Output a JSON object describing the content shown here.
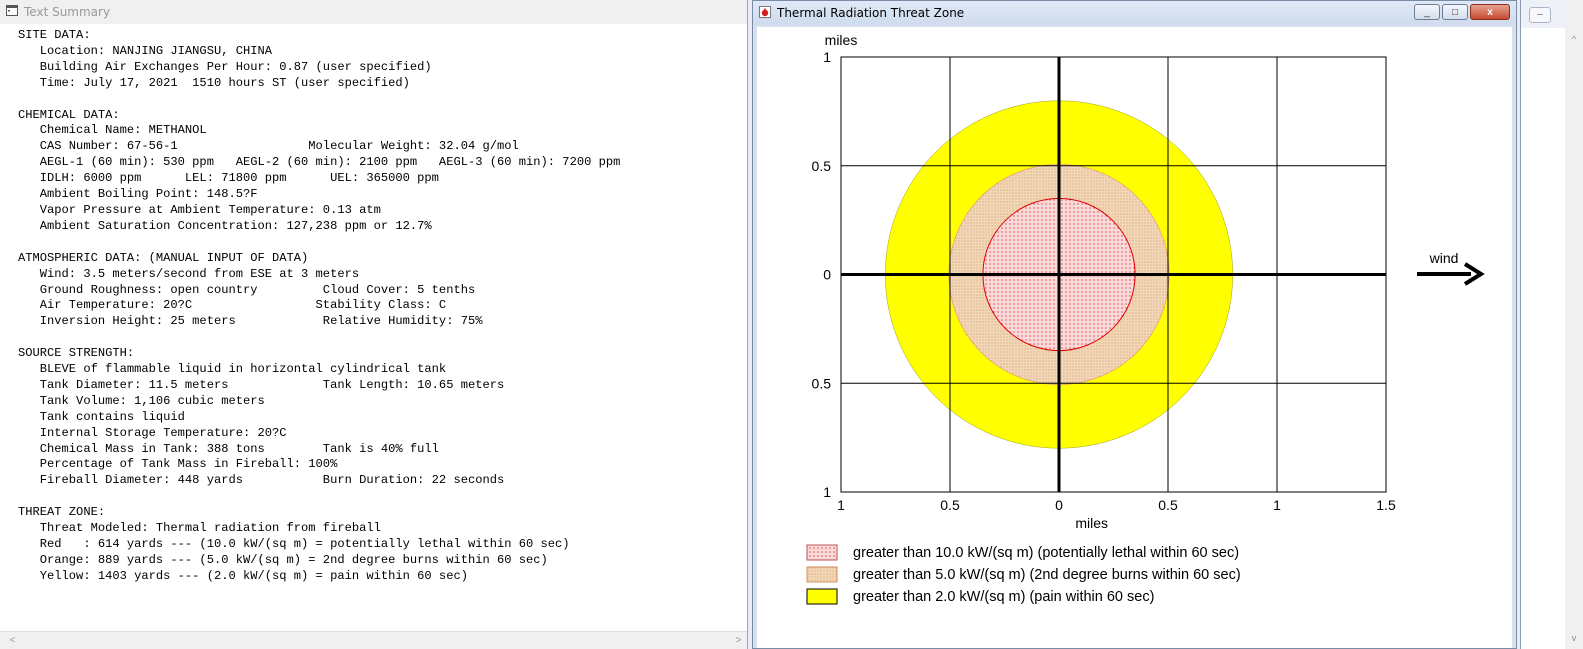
{
  "summary_window": {
    "title": "Text Summary",
    "lines": [
      "SITE DATA:",
      "   Location: NANJING JIANGSU, CHINA",
      "   Building Air Exchanges Per Hour: 0.87 (user specified)",
      "   Time: July 17, 2021  1510 hours ST (user specified)",
      "",
      "CHEMICAL DATA:",
      "   Chemical Name: METHANOL",
      "   CAS Number: 67-56-1                  Molecular Weight: 32.04 g/mol",
      "   AEGL-1 (60 min): 530 ppm   AEGL-2 (60 min): 2100 ppm   AEGL-3 (60 min): 7200 ppm",
      "   IDLH: 6000 ppm      LEL: 71800 ppm      UEL: 365000 ppm",
      "   Ambient Boiling Point: 148.5?F",
      "   Vapor Pressure at Ambient Temperature: 0.13 atm",
      "   Ambient Saturation Concentration: 127,238 ppm or 12.7%",
      "",
      "ATMOSPHERIC DATA: (MANUAL INPUT OF DATA)",
      "   Wind: 3.5 meters/second from ESE at 3 meters",
      "   Ground Roughness: open country         Cloud Cover: 5 tenths",
      "   Air Temperature: 20?C                 Stability Class: C",
      "   Inversion Height: 25 meters            Relative Humidity: 75%",
      "",
      "SOURCE STRENGTH:",
      "   BLEVE of flammable liquid in horizontal cylindrical tank",
      "   Tank Diameter: 11.5 meters             Tank Length: 10.65 meters",
      "   Tank Volume: 1,106 cubic meters",
      "   Tank contains liquid",
      "   Internal Storage Temperature: 20?C",
      "   Chemical Mass in Tank: 388 tons        Tank is 40% full",
      "   Percentage of Tank Mass in Fireball: 100%",
      "   Fireball Diameter: 448 yards           Burn Duration: 22 seconds",
      "",
      "THREAT ZONE:",
      "   Threat Modeled: Thermal radiation from fireball",
      "   Red   : 614 yards --- (10.0 kW/(sq m) = potentially lethal within 60 sec)",
      "   Orange: 889 yards --- (5.0 kW/(sq m) = 2nd degree burns within 60 sec)",
      "   Yellow: 1403 yards --- (2.0 kW/(sq m) = pain within 60 sec)"
    ]
  },
  "threat_window": {
    "title": "Thermal Radiation Threat Zone",
    "buttons": {
      "minimize": "_",
      "maximize": "□",
      "close": "x"
    }
  },
  "colors": {
    "red": "#e00000",
    "red_fill": "#f8dada",
    "orange_fill": "#f2d8b8",
    "orange_stroke": "#e8a070",
    "yellow": "#ffff00"
  },
  "chart_data": {
    "type": "area",
    "y_axis_label": "miles",
    "x_axis_label": "miles",
    "x_ticks": [
      "1",
      "0.5",
      "0",
      "0.5",
      "1",
      "1.5"
    ],
    "x_tick_values": [
      -1,
      -0.5,
      0,
      0.5,
      1,
      1.5
    ],
    "y_ticks": [
      "1",
      "0.5",
      "0",
      "0.5",
      "1"
    ],
    "y_tick_values": [
      1,
      0.5,
      0,
      -0.5,
      -1
    ],
    "xlim": [
      -1,
      1.5
    ],
    "ylim": [
      -1,
      1
    ],
    "grid": true,
    "wind_label": "wind",
    "zones": [
      {
        "name": "Red",
        "radius": 0.349,
        "legend": "greater than 10.0 kW/(sq m) (potentially lethal within 60 sec)"
      },
      {
        "name": "Orange",
        "radius": 0.505,
        "legend": "greater than 5.0 kW/(sq m) (2nd degree burns within 60 sec)"
      },
      {
        "name": "Yellow",
        "radius": 0.797,
        "legend": "greater than 2.0 kW/(sq m) (pain within 60 sec)"
      }
    ]
  }
}
